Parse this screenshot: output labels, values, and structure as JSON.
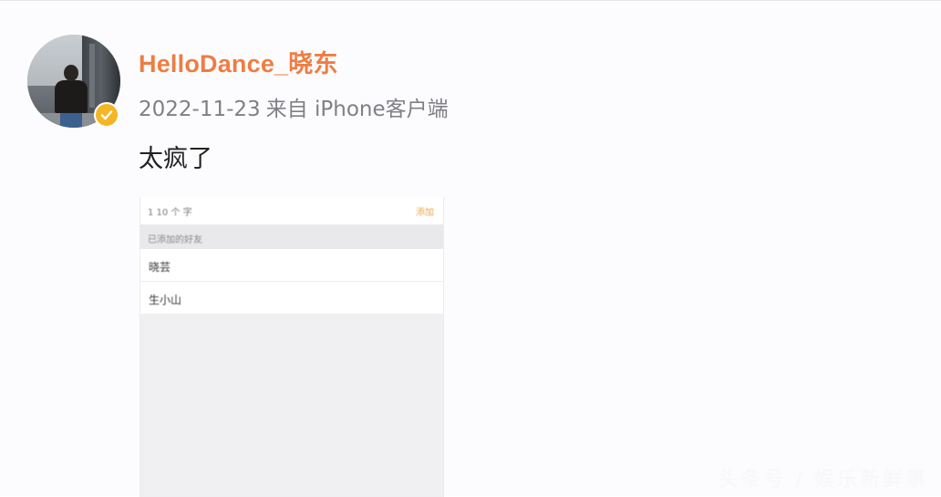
{
  "post": {
    "username": "HelloDance_晓东",
    "date": "2022-11-23",
    "source": "来自 iPhone客户端",
    "text": "太疯了"
  },
  "embedded_screenshot": {
    "count_text": "1 10 个 字",
    "action_text": "添加",
    "section_label": "已添加的好友",
    "items": [
      {
        "label": "晓芸"
      },
      {
        "label": "生小山"
      }
    ]
  },
  "icons": {
    "verified": "verified-badge-icon",
    "verified_color": "#f5b623"
  },
  "colors": {
    "username": "#ee7d43",
    "meta": "#7f7f86",
    "text": "#222222"
  },
  "watermark": "头条号 / 娱乐新鲜事"
}
